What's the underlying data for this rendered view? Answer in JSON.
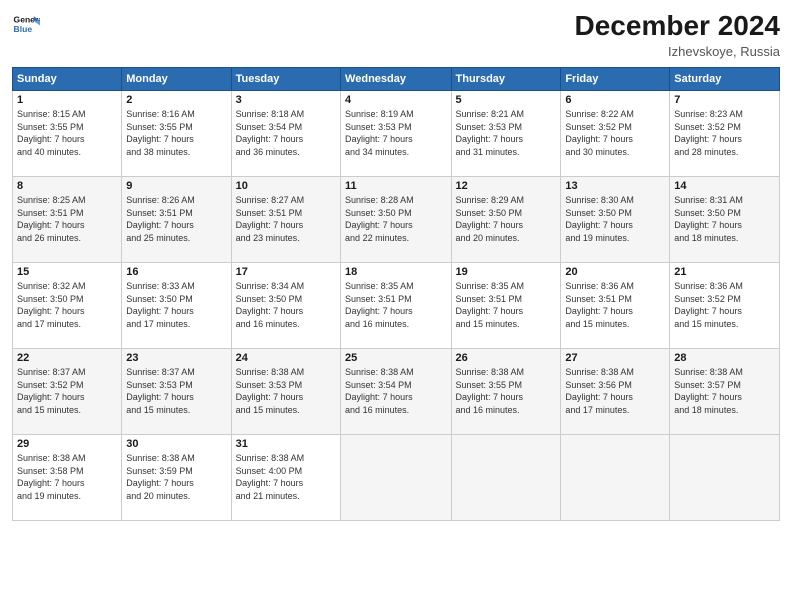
{
  "header": {
    "logo_line1": "General",
    "logo_line2": "Blue",
    "month": "December 2024",
    "location": "Izhevskoye, Russia"
  },
  "weekdays": [
    "Sunday",
    "Monday",
    "Tuesday",
    "Wednesday",
    "Thursday",
    "Friday",
    "Saturday"
  ],
  "weeks": [
    [
      {
        "day": "1",
        "sunrise": "8:15 AM",
        "sunset": "3:55 PM",
        "daylight": "7 hours and 40 minutes."
      },
      {
        "day": "2",
        "sunrise": "8:16 AM",
        "sunset": "3:55 PM",
        "daylight": "7 hours and 38 minutes."
      },
      {
        "day": "3",
        "sunrise": "8:18 AM",
        "sunset": "3:54 PM",
        "daylight": "7 hours and 36 minutes."
      },
      {
        "day": "4",
        "sunrise": "8:19 AM",
        "sunset": "3:53 PM",
        "daylight": "7 hours and 34 minutes."
      },
      {
        "day": "5",
        "sunrise": "8:21 AM",
        "sunset": "3:53 PM",
        "daylight": "7 hours and 31 minutes."
      },
      {
        "day": "6",
        "sunrise": "8:22 AM",
        "sunset": "3:52 PM",
        "daylight": "7 hours and 30 minutes."
      },
      {
        "day": "7",
        "sunrise": "8:23 AM",
        "sunset": "3:52 PM",
        "daylight": "7 hours and 28 minutes."
      }
    ],
    [
      {
        "day": "8",
        "sunrise": "8:25 AM",
        "sunset": "3:51 PM",
        "daylight": "7 hours and 26 minutes."
      },
      {
        "day": "9",
        "sunrise": "8:26 AM",
        "sunset": "3:51 PM",
        "daylight": "7 hours and 25 minutes."
      },
      {
        "day": "10",
        "sunrise": "8:27 AM",
        "sunset": "3:51 PM",
        "daylight": "7 hours and 23 minutes."
      },
      {
        "day": "11",
        "sunrise": "8:28 AM",
        "sunset": "3:50 PM",
        "daylight": "7 hours and 22 minutes."
      },
      {
        "day": "12",
        "sunrise": "8:29 AM",
        "sunset": "3:50 PM",
        "daylight": "7 hours and 20 minutes."
      },
      {
        "day": "13",
        "sunrise": "8:30 AM",
        "sunset": "3:50 PM",
        "daylight": "7 hours and 19 minutes."
      },
      {
        "day": "14",
        "sunrise": "8:31 AM",
        "sunset": "3:50 PM",
        "daylight": "7 hours and 18 minutes."
      }
    ],
    [
      {
        "day": "15",
        "sunrise": "8:32 AM",
        "sunset": "3:50 PM",
        "daylight": "7 hours and 17 minutes."
      },
      {
        "day": "16",
        "sunrise": "8:33 AM",
        "sunset": "3:50 PM",
        "daylight": "7 hours and 17 minutes."
      },
      {
        "day": "17",
        "sunrise": "8:34 AM",
        "sunset": "3:50 PM",
        "daylight": "7 hours and 16 minutes."
      },
      {
        "day": "18",
        "sunrise": "8:35 AM",
        "sunset": "3:51 PM",
        "daylight": "7 hours and 16 minutes."
      },
      {
        "day": "19",
        "sunrise": "8:35 AM",
        "sunset": "3:51 PM",
        "daylight": "7 hours and 15 minutes."
      },
      {
        "day": "20",
        "sunrise": "8:36 AM",
        "sunset": "3:51 PM",
        "daylight": "7 hours and 15 minutes."
      },
      {
        "day": "21",
        "sunrise": "8:36 AM",
        "sunset": "3:52 PM",
        "daylight": "7 hours and 15 minutes."
      }
    ],
    [
      {
        "day": "22",
        "sunrise": "8:37 AM",
        "sunset": "3:52 PM",
        "daylight": "7 hours and 15 minutes."
      },
      {
        "day": "23",
        "sunrise": "8:37 AM",
        "sunset": "3:53 PM",
        "daylight": "7 hours and 15 minutes."
      },
      {
        "day": "24",
        "sunrise": "8:38 AM",
        "sunset": "3:53 PM",
        "daylight": "7 hours and 15 minutes."
      },
      {
        "day": "25",
        "sunrise": "8:38 AM",
        "sunset": "3:54 PM",
        "daylight": "7 hours and 16 minutes."
      },
      {
        "day": "26",
        "sunrise": "8:38 AM",
        "sunset": "3:55 PM",
        "daylight": "7 hours and 16 minutes."
      },
      {
        "day": "27",
        "sunrise": "8:38 AM",
        "sunset": "3:56 PM",
        "daylight": "7 hours and 17 minutes."
      },
      {
        "day": "28",
        "sunrise": "8:38 AM",
        "sunset": "3:57 PM",
        "daylight": "7 hours and 18 minutes."
      }
    ],
    [
      {
        "day": "29",
        "sunrise": "8:38 AM",
        "sunset": "3:58 PM",
        "daylight": "7 hours and 19 minutes."
      },
      {
        "day": "30",
        "sunrise": "8:38 AM",
        "sunset": "3:59 PM",
        "daylight": "7 hours and 20 minutes."
      },
      {
        "day": "31",
        "sunrise": "8:38 AM",
        "sunset": "4:00 PM",
        "daylight": "7 hours and 21 minutes."
      },
      null,
      null,
      null,
      null
    ]
  ],
  "labels": {
    "sunrise": "Sunrise:",
    "sunset": "Sunset:",
    "daylight": "Daylight:"
  }
}
